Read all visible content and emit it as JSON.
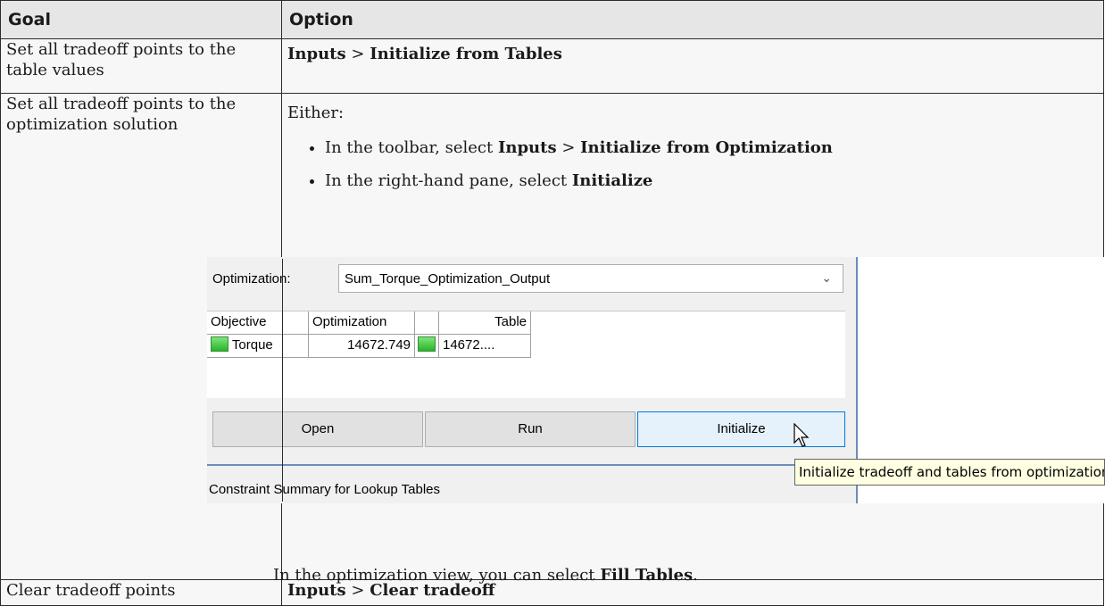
{
  "table": {
    "headers": {
      "goal": "Goal",
      "option": "Option"
    },
    "row1": {
      "goal": "Set all tradeoff points to the table values",
      "option_a": "Inputs",
      "option_sep": ">",
      "option_b": "Initialize from Tables"
    },
    "row2": {
      "goal": "Set all tradeoff points to the optimization solution",
      "either": "Either:",
      "bullet1_pre": "In the toolbar, select ",
      "bullet1_a": "Inputs",
      "bullet1_sep": " > ",
      "bullet1_b": "Initialize from Optimization",
      "bullet2_pre": "In the right-hand pane, select ",
      "bullet2_b": "Initialize",
      "fill_pre": "In the optimization view, you can select ",
      "fill_b": "Fill Tables",
      "fill_post": "."
    },
    "row3": {
      "goal": "Clear tradeoff points",
      "option_a": "Inputs",
      "option_sep": ">",
      "option_b": "Clear tradeoff"
    }
  },
  "screenshot": {
    "optimization_label": "Optimization:",
    "optimization_value": "Sum_Torque_Optimization_Output",
    "grid_headers": {
      "objective": "Objective",
      "optimization": "Optimization",
      "table": "Table"
    },
    "grid_row": {
      "objective": "Torque",
      "optimization": "14672.749",
      "table": "14672...."
    },
    "buttons": {
      "open": "Open",
      "run": "Run",
      "initialize": "Initialize"
    },
    "summary": "Constraint Summary for Lookup Tables",
    "tooltip": "Initialize tradeoff and tables from optimization"
  },
  "colors": {
    "header_bg": "#e6e6e6",
    "cell_bg": "#f7f7f7",
    "tooltip_bg": "#ffffe1",
    "active_button": "#e5f1fb"
  }
}
